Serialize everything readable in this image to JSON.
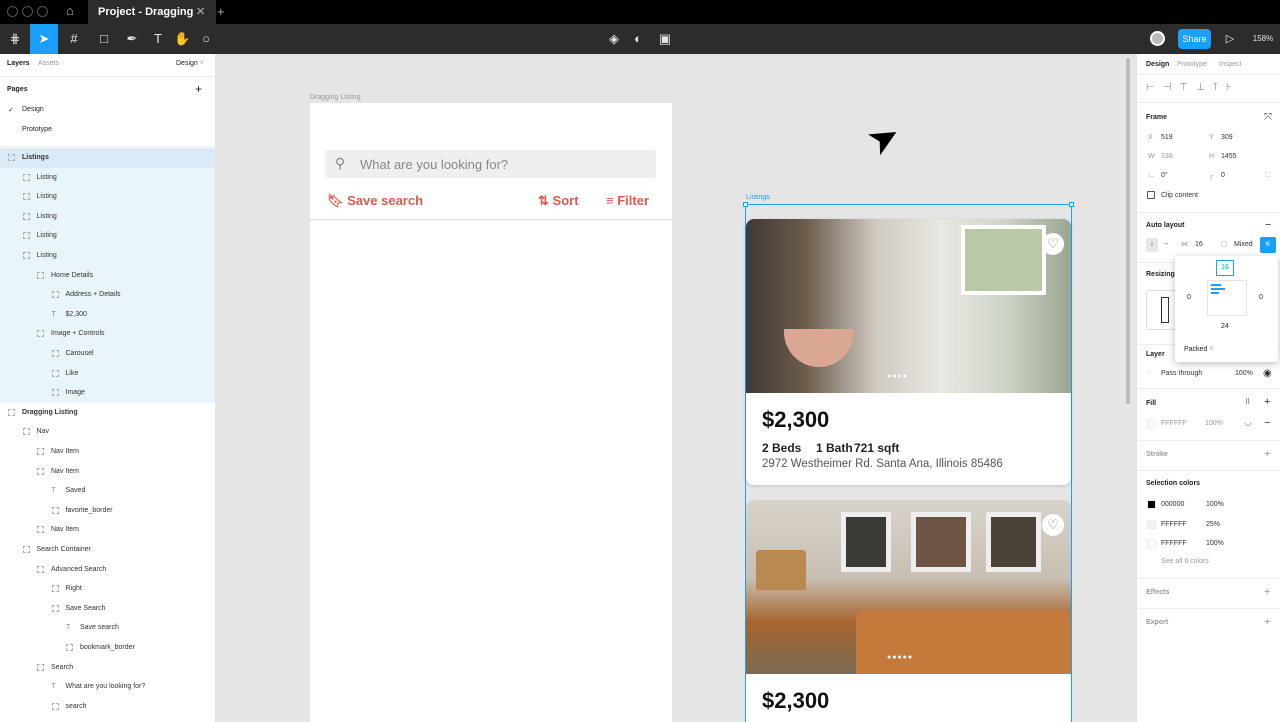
{
  "titlebar": {
    "tab_title": "Project - Dragging WIP",
    "new_tab": "+"
  },
  "toolbar": {
    "share": "Share",
    "zoom": "158%",
    "play": "▷"
  },
  "left": {
    "tabs": {
      "layers": "Layers",
      "assets": "Assets",
      "page_select": "Design"
    },
    "pages_title": "Pages",
    "add": "+",
    "pages": [
      "Design",
      "Prototype"
    ],
    "layers": [
      {
        "label": "Listings",
        "indent": 0,
        "bold": true,
        "selected": true
      },
      {
        "label": "Listing",
        "indent": 1,
        "sel": true
      },
      {
        "label": "Listing",
        "indent": 1,
        "sel": true
      },
      {
        "label": "Listing",
        "indent": 1,
        "sel": true
      },
      {
        "label": "Listing",
        "indent": 1,
        "sel": true
      },
      {
        "label": "Listing",
        "indent": 1,
        "sel": true
      },
      {
        "label": "Home Details",
        "indent": 2,
        "sel": true
      },
      {
        "label": "Address + Details",
        "indent": 3,
        "sel": true
      },
      {
        "label": "$2,300",
        "indent": 3,
        "sel": true,
        "text": true
      },
      {
        "label": "Image + Controls",
        "indent": 2,
        "sel": true
      },
      {
        "label": "Carousel",
        "indent": 3,
        "sel": true
      },
      {
        "label": "Like",
        "indent": 3,
        "sel": true
      },
      {
        "label": "Image",
        "indent": 3,
        "sel": true
      },
      {
        "label": "Dragging Listing",
        "indent": 0,
        "bold": true
      },
      {
        "label": "Nav",
        "indent": 1
      },
      {
        "label": "Nav Item",
        "indent": 2
      },
      {
        "label": "Nav Item",
        "indent": 2
      },
      {
        "label": "Saved",
        "indent": 3,
        "text": true
      },
      {
        "label": "favorite_border",
        "indent": 3
      },
      {
        "label": "Nav Item",
        "indent": 2
      },
      {
        "label": "Search Container",
        "indent": 1
      },
      {
        "label": "Advanced Search",
        "indent": 2
      },
      {
        "label": "Right",
        "indent": 3
      },
      {
        "label": "Save Search",
        "indent": 3
      },
      {
        "label": "Save search",
        "indent": 4,
        "text": true
      },
      {
        "label": "bookmark_border",
        "indent": 4
      },
      {
        "label": "Search",
        "indent": 2
      },
      {
        "label": "What are you looking for?",
        "indent": 3,
        "text": true
      },
      {
        "label": "search",
        "indent": 3
      }
    ]
  },
  "canvas": {
    "frame1_label": "Dragging Listing",
    "search_placeholder": "What are you looking for?",
    "save_search": "Save search",
    "sort": "Sort",
    "filter": "Filter",
    "frame2_label": "Listings",
    "listing1": {
      "price": "$2,300",
      "beds": "2 Beds",
      "bath": "1 Bath",
      "sqft": "721 sqft",
      "address": "2972 Westheimer Rd. Santa Ana, Illinois 85486"
    },
    "listing2": {
      "price": "$2,300"
    }
  },
  "right": {
    "tabs": {
      "design": "Design",
      "prototype": "Prototype",
      "inspect": "Inspect"
    },
    "frame_title": "Frame",
    "x_label": "X",
    "x": "519",
    "y_label": "Y",
    "y": "309",
    "w_label": "W",
    "w": "338",
    "h_label": "H",
    "h": "1455",
    "rotation": "0°",
    "radius": "0",
    "clip": "Clip content",
    "autolayout_title": "Auto layout",
    "spacing": "16",
    "mixed": "Mixed",
    "popup": {
      "top": "16",
      "left": "0",
      "right": "0",
      "bottom": "24",
      "packed": "Packed"
    },
    "resizing_title": "Resizing",
    "layer_title": "Layer",
    "blend": "Pass through",
    "opacity": "100%",
    "fill_title": "Fill",
    "fill_hex": "FFFFFF",
    "fill_op": "100%",
    "stroke_title": "Stroke",
    "selcolors_title": "Selection colors",
    "colors": [
      {
        "hex": "000000",
        "op": "100%",
        "swatch": "#000000"
      },
      {
        "hex": "FFFFFF",
        "op": "25%",
        "swatch": "#f4f4f4"
      },
      {
        "hex": "FFFFFF",
        "op": "100%",
        "swatch": "#ffffff"
      }
    ],
    "see_all": "See all 6 colors",
    "effects_title": "Effects",
    "export_title": "Export"
  },
  "colors": {
    "accent": "#18a0fb",
    "brand_red": "#e0594f",
    "selection": "#daebf7"
  }
}
